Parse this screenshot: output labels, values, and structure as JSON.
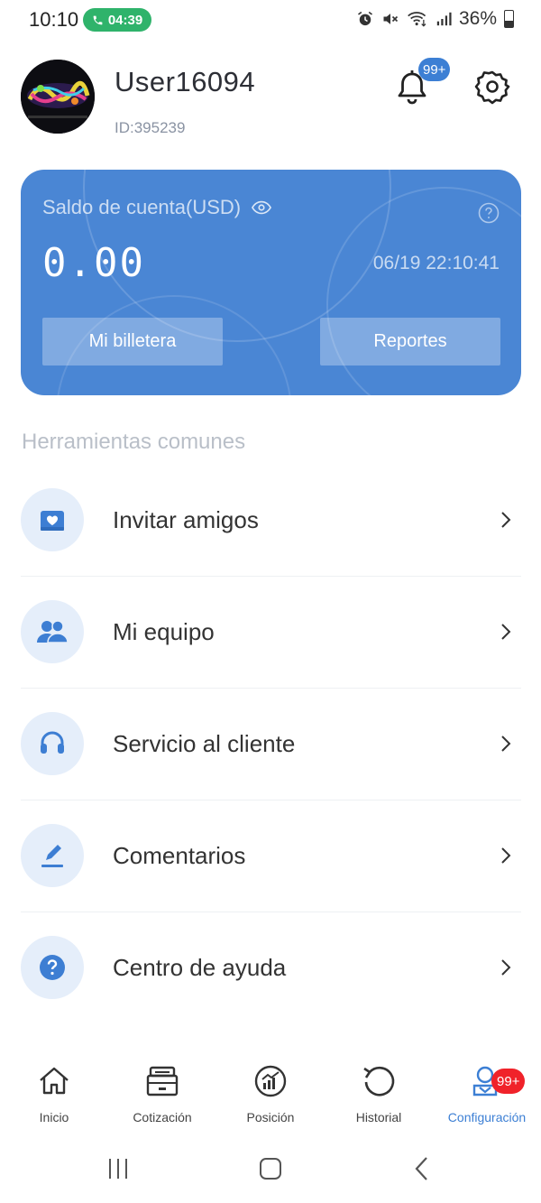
{
  "status_bar": {
    "time": "10:10",
    "call_timer": "04:39",
    "battery": "36%"
  },
  "user": {
    "name": "User16094",
    "id": "ID:395239",
    "notifications_badge": "99+"
  },
  "balance_card": {
    "label": "Saldo de cuenta(USD)",
    "amount": "0.00",
    "timestamp": "06/19 22:10:41",
    "wallet_button": "Mi billetera",
    "reports_button": "Reportes"
  },
  "tools": {
    "title": "Herramientas comunes",
    "items": [
      {
        "label": "Invitar amigos",
        "icon": "invite-icon"
      },
      {
        "label": "Mi equipo",
        "icon": "team-icon"
      },
      {
        "label": "Servicio al cliente",
        "icon": "headset-icon"
      },
      {
        "label": "Comentarios",
        "icon": "pencil-icon"
      },
      {
        "label": "Centro de ayuda",
        "icon": "help-icon"
      }
    ]
  },
  "bottom_nav": {
    "items": [
      "Inicio",
      "Cotización",
      "Posición",
      "Historial",
      "Configuración"
    ],
    "active": "Configuración",
    "config_badge": "99+"
  },
  "colors": {
    "accent": "#3c7fd4",
    "card": "#4a86d4",
    "badge_red": "#f0222a",
    "call_green": "#2fb36b"
  }
}
